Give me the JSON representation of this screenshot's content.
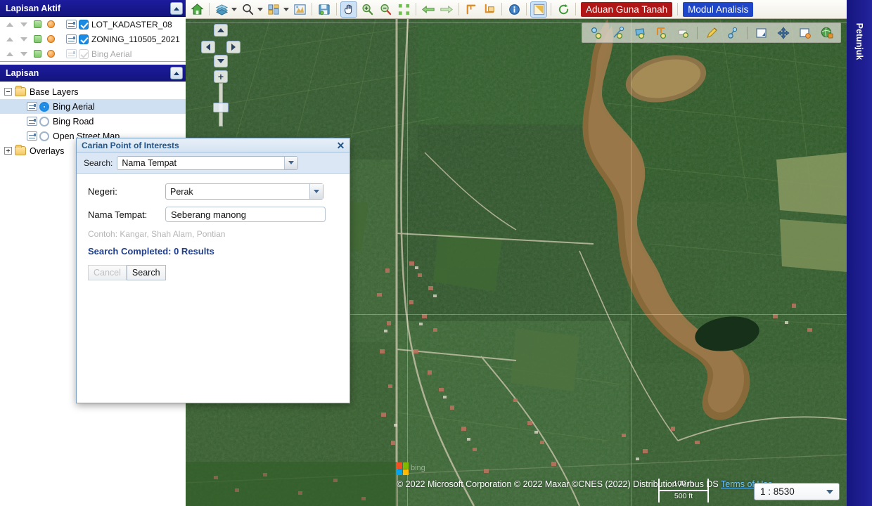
{
  "panels": {
    "active_layers": {
      "title": "Lapisan Aktif",
      "collapse_icon": "chevron-up-icon",
      "rows": [
        {
          "label": "LOT_KADASTER_08",
          "checked": true,
          "enabled": true
        },
        {
          "label": "ZONING_110505_2021",
          "checked": true,
          "enabled": true
        },
        {
          "label": "Bing Aerial",
          "checked": false,
          "enabled": false
        }
      ]
    },
    "layers": {
      "title": "Lapisan",
      "collapse_icon": "chevron-up-icon",
      "tree": [
        {
          "label": "Base Layers",
          "type": "folder",
          "expanded": true
        },
        {
          "label": "Bing Aerial",
          "type": "radio",
          "selected": true
        },
        {
          "label": "Bing Road",
          "type": "radio",
          "selected": false
        },
        {
          "label": "Open Street Map",
          "type": "radio",
          "selected": false
        },
        {
          "label": "Overlays",
          "type": "folder",
          "expanded": false
        }
      ]
    }
  },
  "toolbar": {
    "buttons": [
      {
        "name": "home-icon",
        "title": "Home"
      },
      {
        "name": "layers-icon",
        "title": "Layers"
      },
      {
        "name": "zoom-search-icon",
        "title": "Search"
      },
      {
        "name": "legend-icon",
        "title": "Legend"
      },
      {
        "name": "export-image-icon",
        "title": "Export Image"
      },
      {
        "name": "save-icon",
        "title": "Save"
      },
      {
        "name": "pan-hand-icon",
        "title": "Pan",
        "active": true
      },
      {
        "name": "zoom-in-icon",
        "title": "Zoom In"
      },
      {
        "name": "zoom-out-icon",
        "title": "Zoom Out"
      },
      {
        "name": "zoom-extent-icon",
        "title": "Zoom to Extent"
      },
      {
        "name": "back-arrow-icon",
        "title": "Previous Extent"
      },
      {
        "name": "forward-arrow-icon",
        "title": "Next Extent"
      },
      {
        "name": "measure-length-icon",
        "title": "Measure Length"
      },
      {
        "name": "measure-area-icon",
        "title": "Measure Area"
      },
      {
        "name": "info-icon",
        "title": "Identify"
      },
      {
        "name": "select-icon",
        "title": "Select"
      },
      {
        "name": "refresh-icon",
        "title": "Refresh"
      }
    ],
    "tab_aduan": "Aduan Guna Tanah",
    "tab_modul": "Modul Analisis",
    "tab_aduan_color": "#b01616",
    "tab_modul_color": "#1f46c8"
  },
  "map_toolbar": {
    "buttons": [
      {
        "name": "create-point-icon",
        "title": "Create Point"
      },
      {
        "name": "create-line-icon",
        "title": "Create Line"
      },
      {
        "name": "create-polygon-icon",
        "title": "Create Polygon"
      },
      {
        "name": "create-rectangle-icon",
        "title": "Create Rectangle"
      },
      {
        "name": "create-freehand-icon",
        "title": "Create Freehand"
      },
      {
        "name": "edit-pencil-icon",
        "title": "Edit Feature"
      },
      {
        "name": "edit-vertex-icon",
        "title": "Edit Vertex"
      },
      {
        "name": "select-box-icon",
        "title": "Select Box"
      },
      {
        "name": "move-icon",
        "title": "Move"
      },
      {
        "name": "delete-shape-icon",
        "title": "Delete"
      },
      {
        "name": "globe-lock-icon",
        "title": "Save Edits"
      }
    ]
  },
  "nav_control": {
    "up": "pan-up-icon",
    "down": "pan-down-icon",
    "left": "pan-left-icon",
    "right": "pan-right-icon",
    "zoom_in": "+",
    "zoom_out": "−"
  },
  "map_footer": {
    "attribution": "© 2022 Microsoft Corporation © 2022 Maxar ©CNES (2022) Distribution Airbus DS",
    "terms_link": "Terms of Use",
    "watermark": "bing",
    "scale_metric": "100 m",
    "scale_imperial": "500 ft",
    "scale_value": "1 : 8530"
  },
  "right_rail": {
    "label": "Petunjuk"
  },
  "dialog": {
    "title": "Carian Point of Interests",
    "close_icon": "close-icon",
    "search_label": "Search:",
    "search_type_value": "Nama Tempat",
    "fields": [
      {
        "label": "Negeri:",
        "value": "Perak",
        "kind": "combo"
      },
      {
        "label": "Nama Tempat:",
        "value": "Seberang manong",
        "kind": "text"
      }
    ],
    "hint": "Contoh: Kangar, Shah Alam, Pontian",
    "status": "Search Completed: 0 Results",
    "cancel_label": "Cancel",
    "search_label_btn": "Search"
  }
}
